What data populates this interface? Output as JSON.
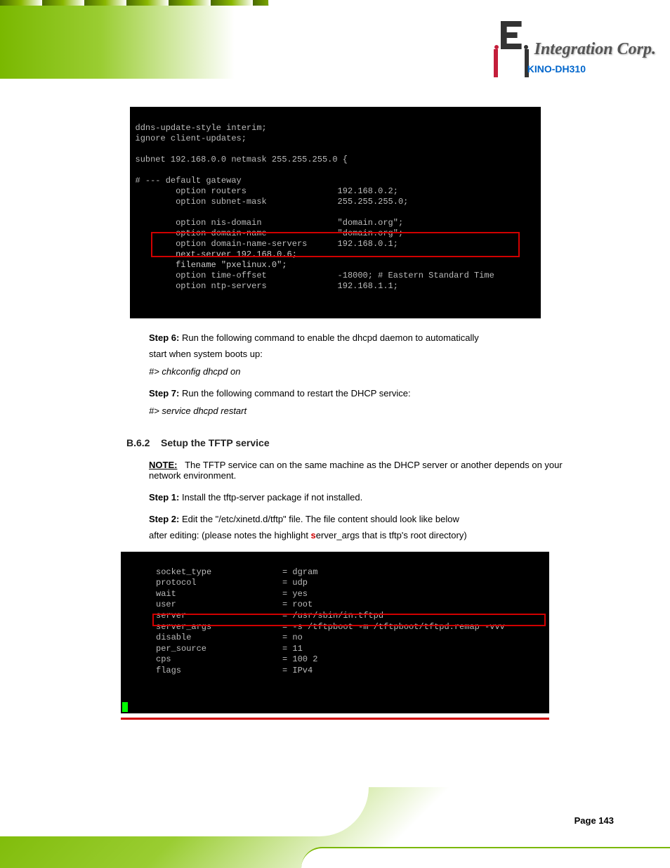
{
  "header": {
    "logo_text": "Integration Corp.",
    "doc_title": "KINO-DH310"
  },
  "terminal1": {
    "lines": [
      "ddns-update-style interim;",
      "ignore client-updates;",
      "",
      "subnet 192.168.0.0 netmask 255.255.255.0 {",
      "",
      "# --- default gateway",
      "        option routers                  192.168.0.2;",
      "        option subnet-mask              255.255.255.0;",
      "",
      "        option nis-domain               \"domain.org\";",
      "        option domain-name              \"domain.org\";",
      "        option domain-name-servers      192.168.0.1;",
      "        next-server 192.168.0.6;",
      "        filename \"pxelinux.0\";",
      "        option time-offset              -18000; # Eastern Standard Time",
      "        option ntp-servers              192.168.1.1;"
    ]
  },
  "step6": {
    "label": "Step 6:",
    "body_line1": "Run the following command to enable the dhcpd daemon to automatically",
    "body_line2": "start when system boots up:",
    "cmd": "#> chkconfig dhcpd on"
  },
  "step7": {
    "label": "Step 7:",
    "body": "Run the following command to restart the DHCP service:",
    "cmd": "#> service dhcpd restart"
  },
  "section": {
    "number": "B.6.2",
    "title": "Setup the TFTP service"
  },
  "note": {
    "label": "NOTE:",
    "body": "The TFTP service can on the same machine as the DHCP server or another depends on your network environment."
  },
  "tftp_step1": {
    "label": "Step 1:",
    "body": "Install the tftp-server package if not installed."
  },
  "tftp_step2": {
    "label": "Step 2:",
    "body_line1": "Edit the \"/etc/xinetd.d/tftp\" file. The file content should look like below",
    "body_line2": "after editing: (please notes the highlight ",
    "red_char": "s",
    "body_line2_cont": "erver_args that is tftp's root directory)"
  },
  "terminal2": {
    "lines": [
      {
        "k": "socket_type",
        "v": "= dgram"
      },
      {
        "k": "protocol",
        "v": "= udp"
      },
      {
        "k": "wait",
        "v": "= yes"
      },
      {
        "k": "user",
        "v": "= root"
      },
      {
        "k": "server",
        "v": "= /usr/sbin/in.tftpd"
      },
      {
        "k": "server_args",
        "v": "= -s /tftpboot -m /tftpboot/tftpd.remap -vvv"
      },
      {
        "k": "disable",
        "v": "= no"
      },
      {
        "k": "per_source",
        "v": "= 11"
      },
      {
        "k": "cps",
        "v": "= 100 2"
      },
      {
        "k": "flags",
        "v": "= IPv4"
      }
    ]
  },
  "footer": {
    "page": "Page 143"
  }
}
